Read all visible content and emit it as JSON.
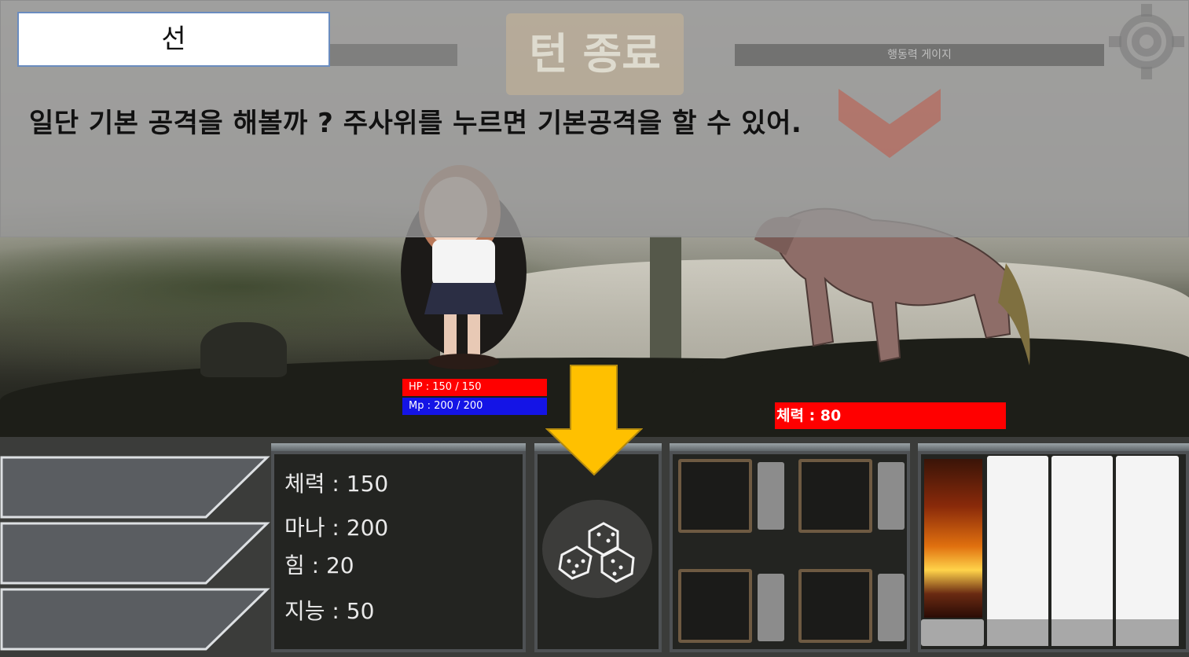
{
  "dialog": {
    "speaker": "선",
    "text": "일단 기본 공격을 해볼까 ? 주사위를 누르면 기본공격을 할 수 있어."
  },
  "hud": {
    "end_turn_label": "턴 종료",
    "action_gauge_label": "행동력 게이지"
  },
  "player": {
    "hp_text": "HP : 150 / 150",
    "mp_text": "Mp : 200 / 200"
  },
  "enemy": {
    "hp_text": "체력 : 80"
  },
  "stats": {
    "health": "체력 : 150",
    "mana": "마나 : 200",
    "strength": "힘 : 20",
    "intelligence": "지능 : 50"
  },
  "icons": {
    "dice": "dice-icon",
    "tutorial_arrow": "down-arrow-icon",
    "settings": "gear-icon",
    "chevron": "chevron-down-icon"
  },
  "colors": {
    "hp_bar": "#ff0000",
    "mp_bar": "#1414e6",
    "tutorial_arrow": "#ffc000"
  }
}
